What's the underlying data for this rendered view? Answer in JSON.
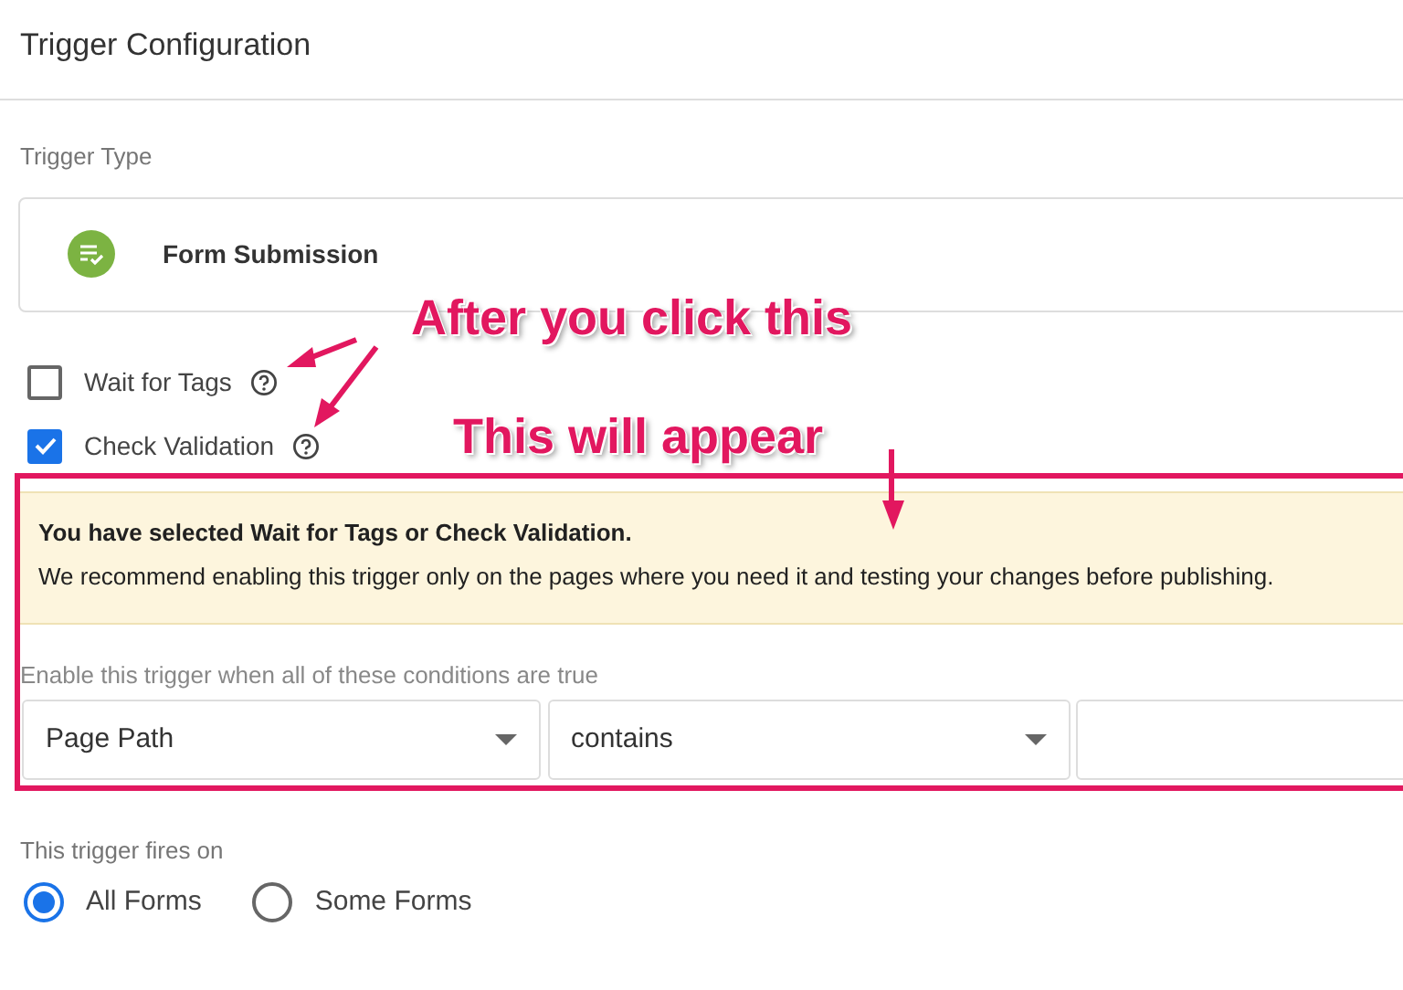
{
  "title": "Trigger Configuration",
  "trigger_type": {
    "label": "Trigger Type",
    "name": "Form Submission"
  },
  "options": [
    {
      "label": "Wait for Tags",
      "checked": false
    },
    {
      "label": "Check Validation",
      "checked": true
    }
  ],
  "annotations": [
    "After you click this",
    "This will appear"
  ],
  "alert": {
    "title": "You have selected Wait for Tags or Check Validation.",
    "body": "We recommend enabling this trigger only on the pages where you need it and testing your changes before publishing."
  },
  "conditions": {
    "label": "Enable this trigger when all of these conditions are true",
    "fields": [
      {
        "kind": "select",
        "value": "Page Path"
      },
      {
        "kind": "select",
        "value": "contains"
      },
      {
        "kind": "text"
      }
    ]
  },
  "fires_on": {
    "label": "This trigger fires on",
    "options": [
      {
        "label": "All Forms",
        "selected": true
      },
      {
        "label": "Some Forms",
        "selected": false
      }
    ]
  }
}
